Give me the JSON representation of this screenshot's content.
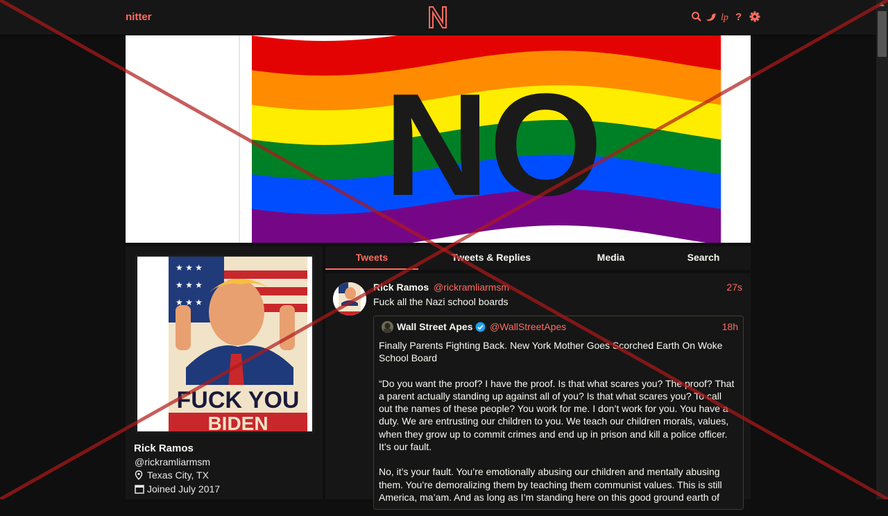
{
  "nav": {
    "brand": "nitter",
    "logo_letter": "N",
    "icons": [
      "search-icon",
      "twitter-icon",
      "lp-icon",
      "help-icon",
      "gear-icon"
    ]
  },
  "banner": {
    "text": "NO",
    "stripe_colors": [
      "#e40303",
      "#ff8c00",
      "#ffed00",
      "#008026",
      "#004dff",
      "#750787"
    ]
  },
  "profile": {
    "avatar_caption_line1": "FUCK YOU",
    "avatar_caption_line2": "BIDEN",
    "name": "Rick Ramos",
    "handle": "@rickramliarmsm",
    "location": "Texas City, TX",
    "joined": "Joined July 2017"
  },
  "tabs": [
    {
      "label": "Tweets",
      "active": true
    },
    {
      "label": "Tweets & Replies",
      "active": false
    },
    {
      "label": "Media",
      "active": false
    },
    {
      "label": "Search",
      "active": false
    }
  ],
  "tweet": {
    "name": "Rick Ramos",
    "handle": "@rickramliarmsm",
    "time": "27s",
    "text": "Fuck all the Nazi school boards",
    "quote": {
      "name": "Wall Street Apes",
      "verified": true,
      "handle": "@WallStreetApes",
      "time": "18h",
      "paragraphs": [
        "Finally Parents Fighting Back. New York Mother Goes Scorched Earth On Woke School Board",
        "“Do you want the proof? I have the proof. Is that what scares you? The proof? That a parent actually standing up against all of you? Is that what scares you? To call out the names of these people? You work for me. I don’t work for you. You have a duty. We are entrusting our children to you. We teach our children morals, values, when they grow up to commit crimes and end up in prison and kill a police officer. It’s our fault.",
        "No, it’s your fault. You’re emotionally abusing our children and mentally abusing them. You’re demoralizing them by teaching them communist values. This is still America, ma’am. And as long as I’m standing here on this good ground earth of"
      ]
    }
  },
  "colors": {
    "accent": "#ff6c60",
    "background": "#0f0f0f",
    "panel": "#161616",
    "overlay_x": "#b01818"
  }
}
